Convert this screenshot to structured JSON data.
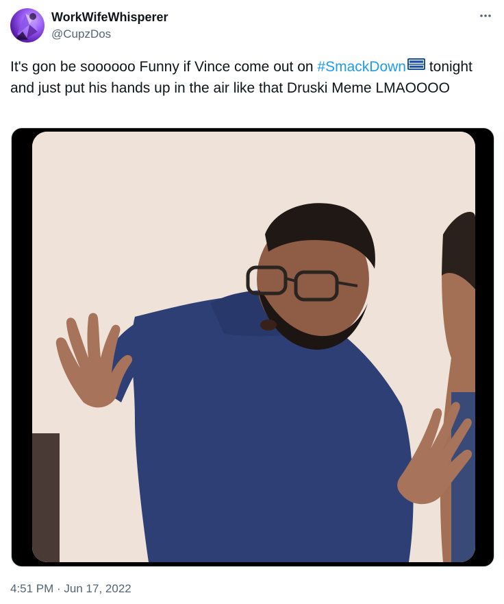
{
  "author": {
    "display_name": "WorkWifeWhisperer",
    "handle": "@CupzDos",
    "avatar_icon": "purple-geometric-avatar"
  },
  "tweet": {
    "text_before": "It's gon be soooooo Funny if Vince come out on ",
    "hashtag": "#SmackDown",
    "hashflag_icon": "smackdown-logo-icon",
    "text_after": " tonight and just put his hands up in the air like that Druski Meme LMAOOOO",
    "timestamp": "4:51 PM · Jun 17, 2022"
  },
  "media": {
    "description_icon": "meme-photo"
  },
  "colors": {
    "text": "#0f1419",
    "secondary": "#536471",
    "link": "#1d9bf0",
    "hashflag_blue": "#1b4fa3"
  },
  "more_icon": "more-dots-icon"
}
